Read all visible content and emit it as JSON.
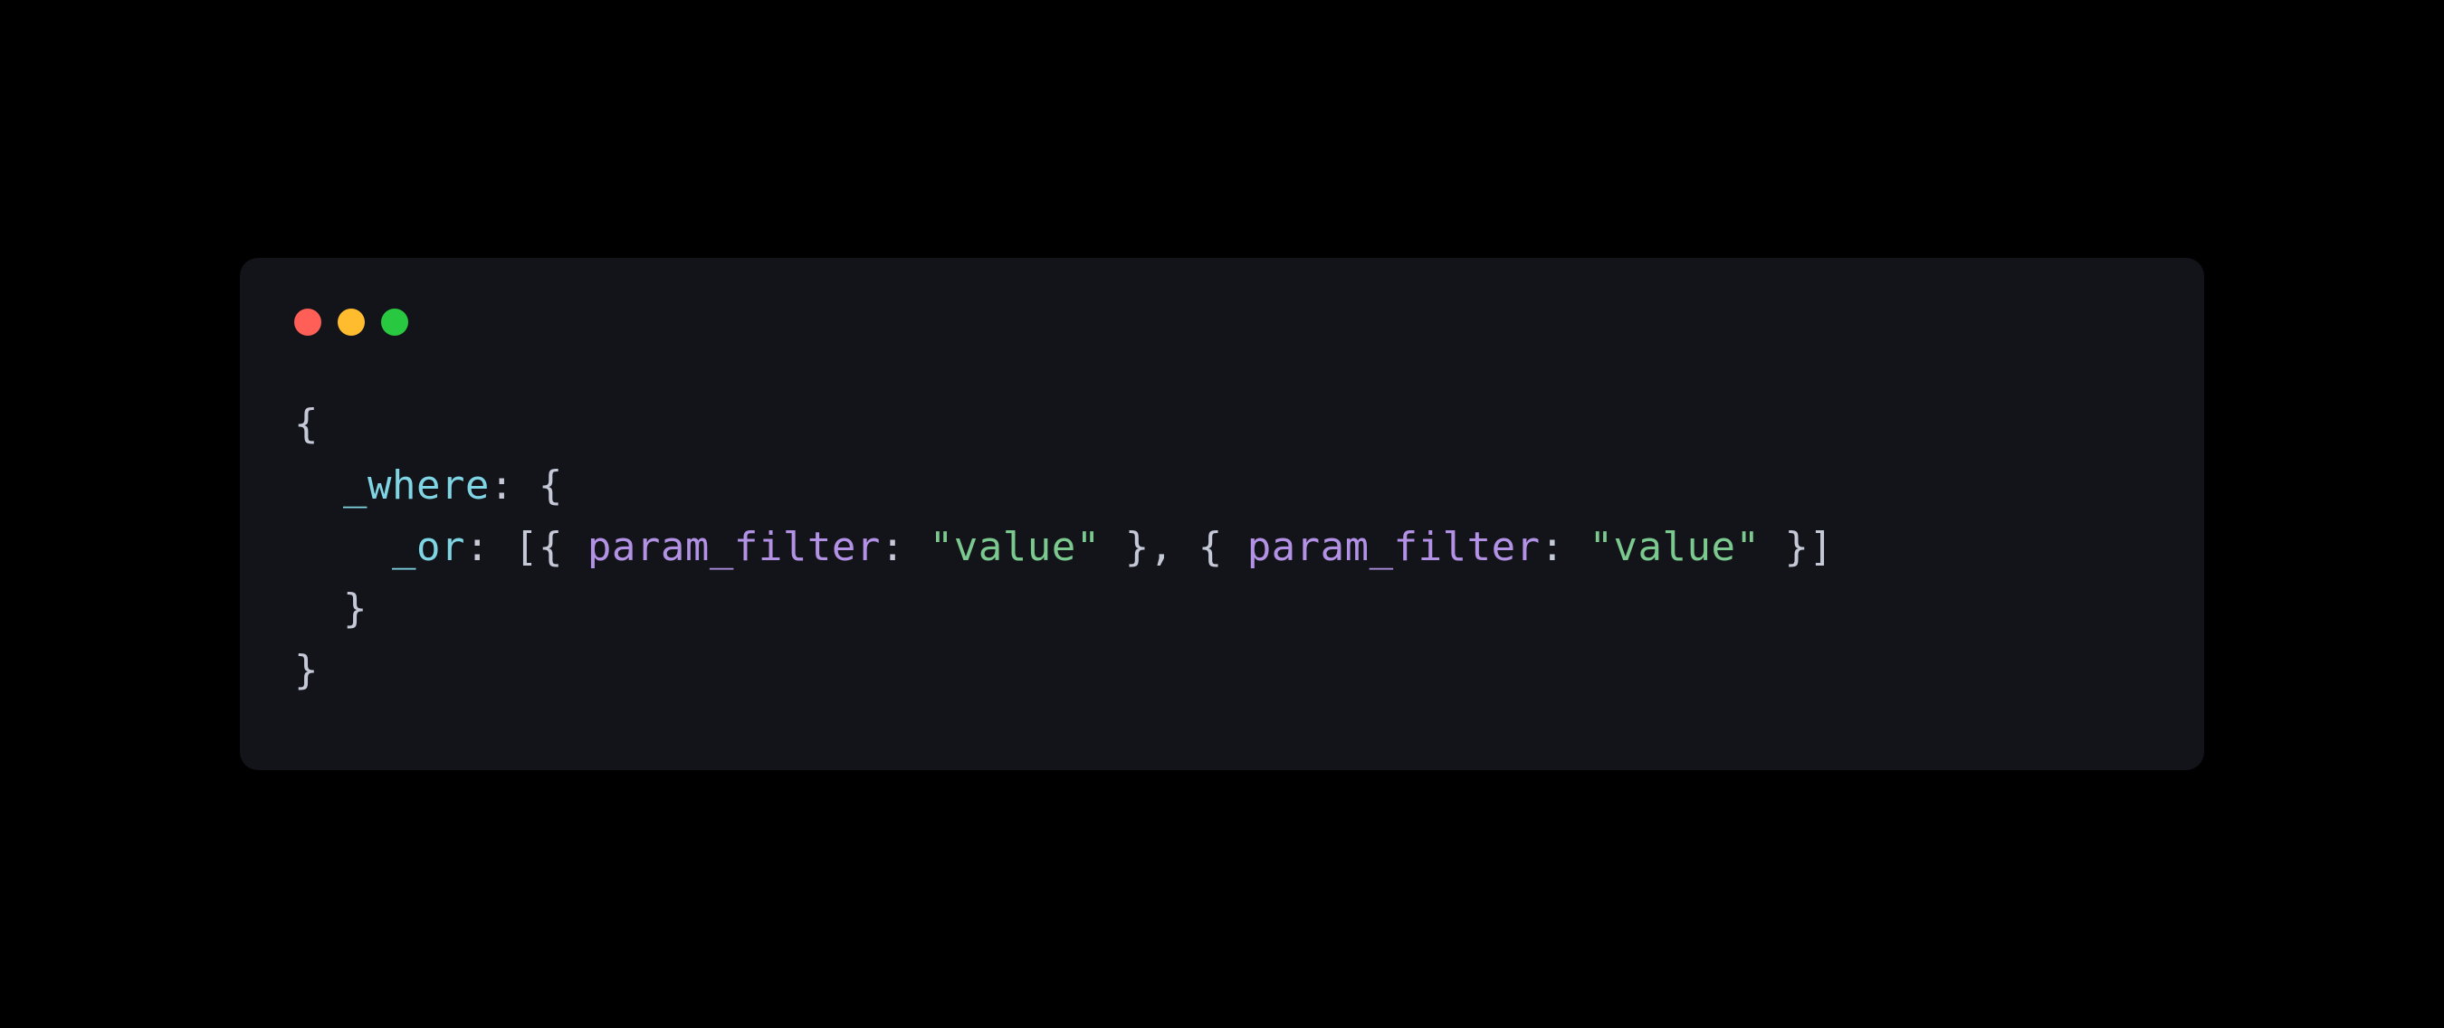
{
  "window": {
    "controls": {
      "close": "close",
      "minimize": "minimize",
      "maximize": "maximize"
    }
  },
  "code": {
    "line1": {
      "brace_open": "{"
    },
    "line2": {
      "indent": "  ",
      "key": "_where",
      "colon": ": ",
      "brace_open": "{"
    },
    "line3": {
      "indent": "    ",
      "key": "_or",
      "colon": ": ",
      "bracket_open": "[",
      "brace_open1": "{ ",
      "prop1": "param_filter",
      "colon1": ": ",
      "string1": "\"value\"",
      "brace_close1": " }",
      "comma": ", ",
      "brace_open2": "{ ",
      "prop2": "param_filter",
      "colon2": ": ",
      "string2": "\"value\"",
      "brace_close2": " }",
      "bracket_close": "]"
    },
    "line4": {
      "indent": "  ",
      "brace_close": "}"
    },
    "line5": {
      "brace_close": "}"
    }
  }
}
